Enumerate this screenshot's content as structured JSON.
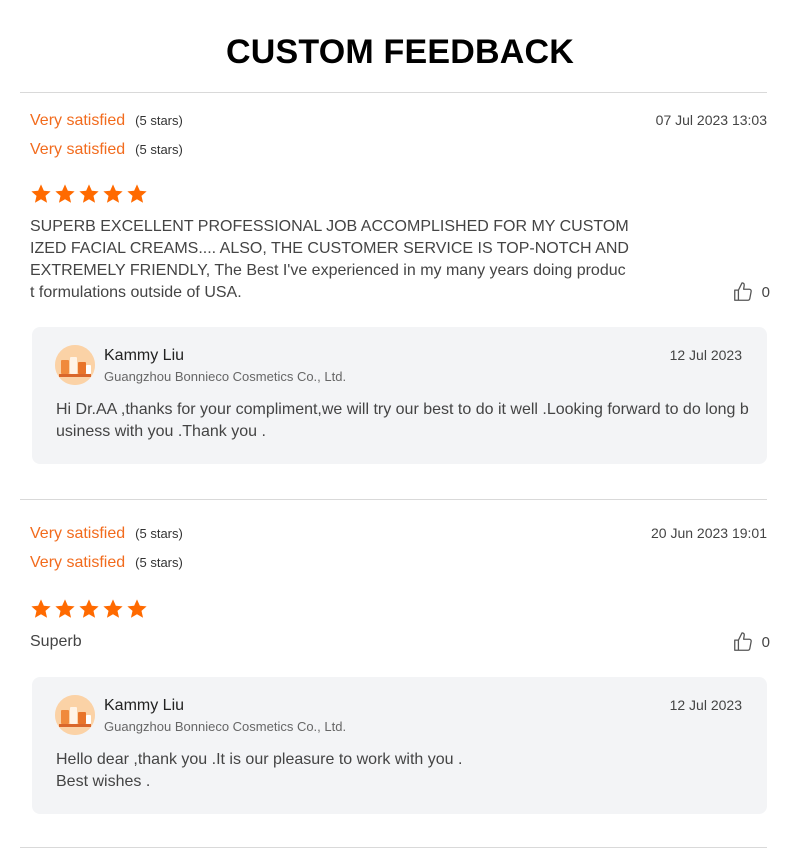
{
  "title": "CUSTOM FEEDBACK",
  "reviews": [
    {
      "ratings": [
        {
          "label": "Very satisfied",
          "stars": "(5 stars)"
        },
        {
          "label": "Very satisfied",
          "stars": "(5 stars)"
        }
      ],
      "date": "07 Jul 2023 13:03",
      "star_count": 5,
      "text": "SUPERB EXCELLENT PROFESSIONAL JOB ACCOMPLISHED FOR MY CUSTOMIZED FACIAL CREAMS.... ALSO, THE CUSTOMER SERVICE IS TOP-NOTCH AND EXTREMELY FRIENDLY, The Best I've experienced in my many years doing product formulations outside of USA.",
      "likes": "0",
      "reply": {
        "name": "Kammy Liu",
        "company": "Guangzhou Bonnieco Cosmetics Co., Ltd.",
        "date": "12 Jul 2023",
        "text": "Hi Dr.AA ,thanks for your  compliment,we will try our best to do it well .Looking forward to do long business with you .Thank you ."
      }
    },
    {
      "ratings": [
        {
          "label": "Very satisfied",
          "stars": "(5 stars)"
        },
        {
          "label": "Very satisfied",
          "stars": "(5 stars)"
        }
      ],
      "date": "20 Jun 2023 19:01",
      "star_count": 5,
      "text": "Superb",
      "likes": "0",
      "reply": {
        "name": "Kammy Liu",
        "company": "Guangzhou Bonnieco Cosmetics Co., Ltd.",
        "date": "12 Jul 2023",
        "text_line1": "Hello dear ,thank you .It is our pleasure to work with you .",
        "text_line2": "Best wishes ."
      }
    }
  ],
  "colors": {
    "accent": "#f26b1d",
    "star": "#ff6a00",
    "reply_bg": "#f3f4f6"
  },
  "icons": {
    "star": "star-icon",
    "like": "thumbs-up-icon",
    "avatar": "company-avatar"
  }
}
